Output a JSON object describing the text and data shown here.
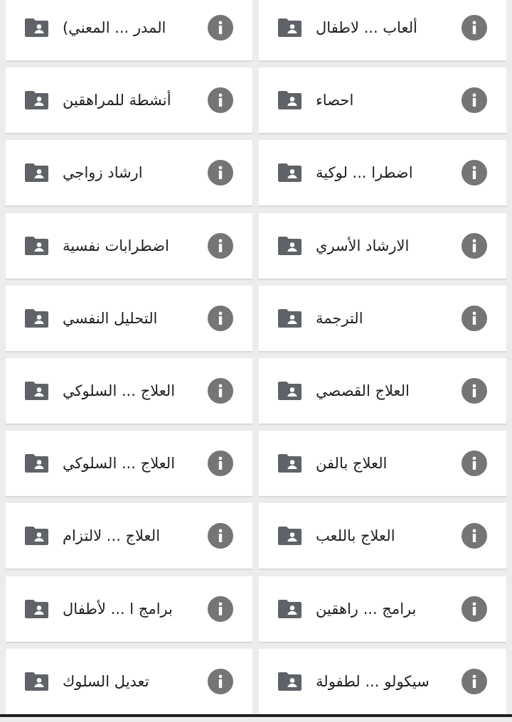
{
  "folders": [
    {
      "name": "ألعاب ... لاطفال"
    },
    {
      "name": "المدر ... المعني)"
    },
    {
      "name": "احصاء"
    },
    {
      "name": "أنشطة للمراهقين"
    },
    {
      "name": "اضطرا ... لوكية"
    },
    {
      "name": "ارشاد زواجي"
    },
    {
      "name": "الارشاد الأسري"
    },
    {
      "name": "اضطرابات نفسية"
    },
    {
      "name": "الترجمة"
    },
    {
      "name": "التحليل النفسي"
    },
    {
      "name": "العلاج القصصي"
    },
    {
      "name": "العلاج ... السلوكي"
    },
    {
      "name": "العلاج بالفن"
    },
    {
      "name": "العلاج ... السلوكي"
    },
    {
      "name": "العلاج باللعب"
    },
    {
      "name": "العلاج ... لالتزام"
    },
    {
      "name": "برامج ... راهقين"
    },
    {
      "name": "برامج ا ... لأطفال"
    },
    {
      "name": "سيكولو ... لطفولة"
    },
    {
      "name": "تعديل السلوك"
    }
  ]
}
